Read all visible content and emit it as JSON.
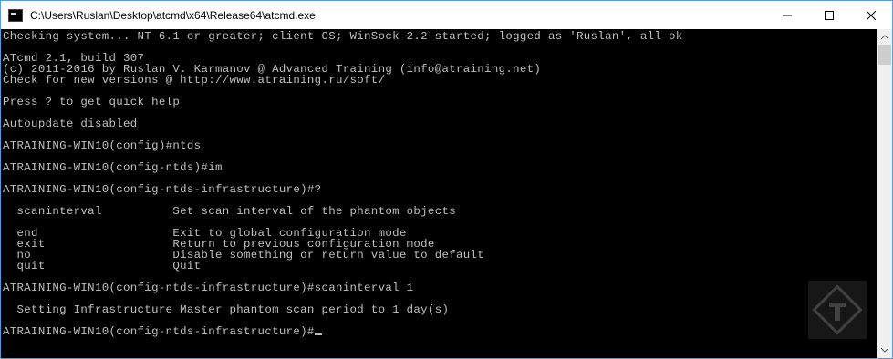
{
  "window": {
    "title": "C:\\Users\\Ruslan\\Desktop\\atcmd\\x64\\Release64\\atcmd.exe",
    "icon": "console-app-icon",
    "controls": {
      "minimize": "minimize-icon",
      "maximize": "maximize-icon",
      "close": "close-icon"
    }
  },
  "console": {
    "text_color": "#c0c0c0",
    "background": "#000000",
    "lines": [
      "Checking system... NT 6.1 or greater; client OS; WinSock 2.2 started; logged as 'Ruslan', all ok",
      "",
      "ATcmd 2.1, build 307",
      "(c) 2011-2016 by Ruslan V. Karmanov @ Advanced Training (info@atraining.net)",
      "Check for new versions @ http://www.atraining.ru/soft/",
      "",
      "Press ? to get quick help",
      "",
      "Autoupdate disabled",
      "",
      "ATRAINING-WIN10(config)#ntds",
      "",
      "ATRAINING-WIN10(config-ntds)#im",
      "",
      "ATRAINING-WIN10(config-ntds-infrastructure)#?",
      "",
      "  scaninterval          Set scan interval of the phantom objects",
      "",
      "  end                   Exit to global configuration mode",
      "  exit                  Return to previous configuration mode",
      "  no                    Disable something or return value to default",
      "  quit                  Quit",
      "",
      "ATRAINING-WIN10(config-ntds-infrastructure)#scaninterval 1",
      "",
      "  Setting Infrastructure Master phantom scan period to 1 day(s)",
      "",
      "ATRAINING-WIN10(config-ntds-infrastructure)#"
    ]
  },
  "scrollbar": {
    "up": "scroll-up-arrow-icon",
    "down": "scroll-down-arrow-icon"
  },
  "watermark": "watermark-logo"
}
